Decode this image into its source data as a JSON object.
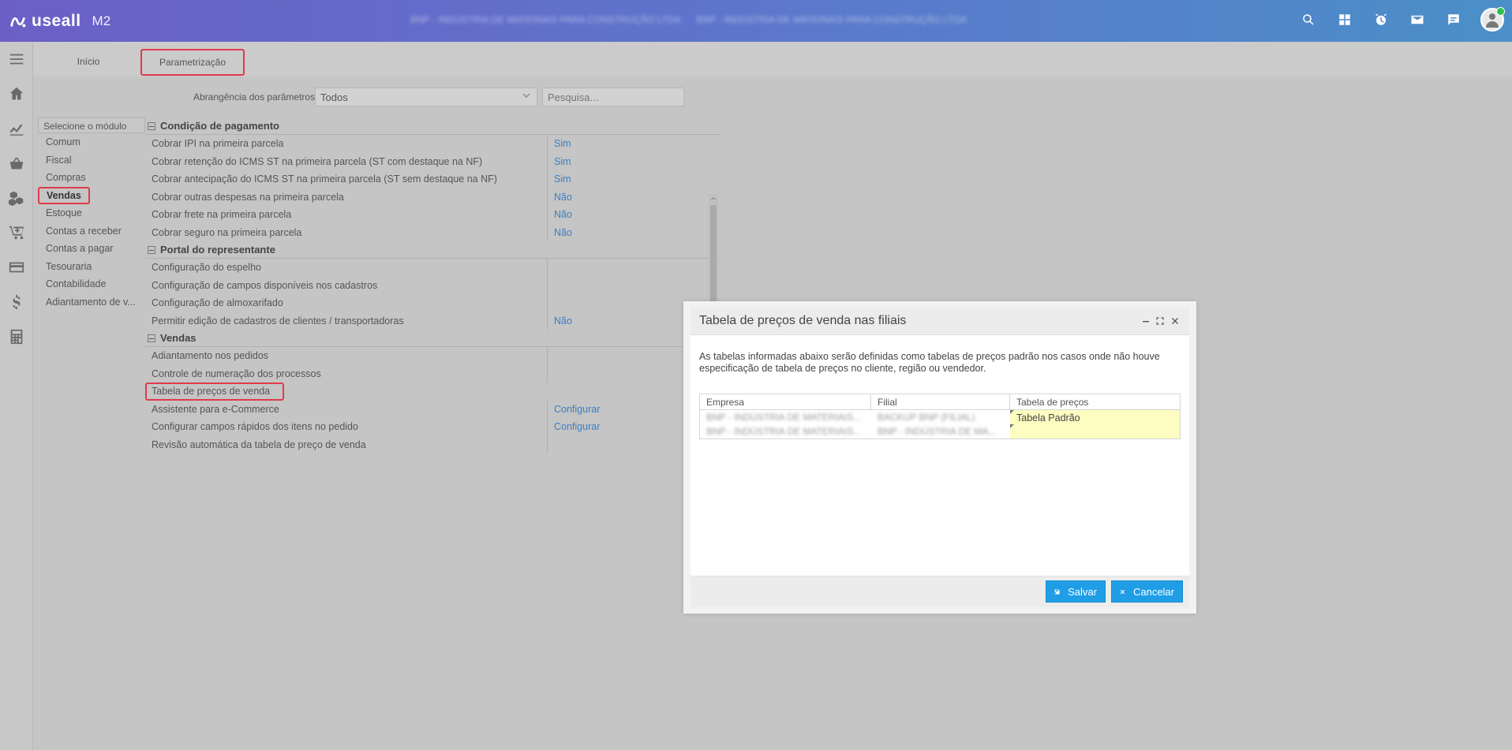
{
  "app": {
    "logo_text": "useall",
    "version": "M2",
    "company_text_1": "BNP - INDÚSTRIA DE MATERIAIS PARA CONSTRUÇÃO LTDA",
    "company_text_2": "BNP - INDÚSTRIA DE MATERIAIS PARA CONSTRUÇÃO LTDA"
  },
  "top_icons": [
    "search-icon",
    "apps-icon",
    "alarm-icon",
    "mail-icon",
    "chat-icon"
  ],
  "tabs": [
    {
      "label": "Início"
    },
    {
      "label": "Parametrização"
    }
  ],
  "filter": {
    "label": "Abrangência dos parâmetros",
    "select_value": "Todos",
    "search_placeholder": "Pesquisa..."
  },
  "modules": {
    "header": "Selecione o módulo",
    "items": [
      "Comum",
      "Fiscal",
      "Compras",
      "Vendas",
      "Estoque",
      "Contas a receber",
      "Contas a pagar",
      "Tesouraria",
      "Contabilidade",
      "Adiantamento de v..."
    ],
    "selected": "Vendas"
  },
  "sections": [
    {
      "title": "Condição de pagamento",
      "rows": [
        {
          "name": "Cobrar IPI na primeira parcela",
          "value": "Sim"
        },
        {
          "name": "Cobrar retenção do ICMS ST na primeira parcela (ST com destaque na NF)",
          "value": "Sim"
        },
        {
          "name": "Cobrar antecipação do ICMS ST na primeira parcela (ST sem destaque na NF)",
          "value": "Sim"
        },
        {
          "name": "Cobrar outras despesas na primeira parcela",
          "value": "Não"
        },
        {
          "name": "Cobrar frete na primeira parcela",
          "value": "Não"
        },
        {
          "name": "Cobrar seguro na primeira parcela",
          "value": "Não"
        }
      ]
    },
    {
      "title": "Portal do representante",
      "rows": [
        {
          "name": "Configuração do espelho",
          "value": ""
        },
        {
          "name": "Configuração de campos disponíveis nos cadastros",
          "value": ""
        },
        {
          "name": "Configuração de almoxarifado",
          "value": ""
        },
        {
          "name": "Permitir edição de cadastros de clientes / transportadoras",
          "value": "Não"
        }
      ]
    },
    {
      "title": "Vendas",
      "rows": [
        {
          "name": "Adiantamento nos pedidos",
          "value": ""
        },
        {
          "name": "Controle de numeração dos processos",
          "value": ""
        },
        {
          "name": "Tabela de preços de venda",
          "value": ""
        },
        {
          "name": "Assistente para e-Commerce",
          "value": "Configurar"
        },
        {
          "name": "Configurar campos rápidos dos itens no pedido",
          "value": "Configurar"
        },
        {
          "name": "Revisão automática da tabela de preço de venda",
          "value": ""
        }
      ]
    }
  ],
  "modal": {
    "title": "Tabela de preços de venda nas filiais",
    "description": "As tabelas informadas abaixo serão definidas como tabelas de preços padrão nos casos onde não houve especificação de tabela de preços no cliente, região ou vendedor.",
    "columns": [
      "Empresa",
      "Filial",
      "Tabela de preços"
    ],
    "rows": [
      {
        "empresa": "BNP - INDÚSTRIA DE MATERIAIS...",
        "filial": "BACKUP BNP (FILIAL)",
        "tabela": "Tabela Padrão"
      },
      {
        "empresa": "BNP - INDÚSTRIA DE MATERIAIS...",
        "filial": "BNP - INDÚSTRIA DE MA...",
        "tabela": ""
      }
    ],
    "save_label": "Salvar",
    "cancel_label": "Cancelar"
  }
}
